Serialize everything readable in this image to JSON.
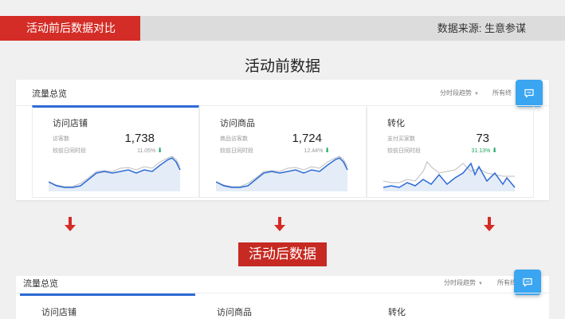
{
  "header": {
    "title": "活动前后数据对比",
    "source": "数据来源: 生意参谋"
  },
  "before": {
    "section_title": "活动前数据",
    "panel_title": "流量总览",
    "trend_select": "分时段趋势",
    "all_select": "所有终",
    "chat_icon": "chat-bubble-icon",
    "cards": [
      {
        "title": "访问店铺",
        "metric": "访客数",
        "compare": "较前日同时段",
        "value": "1,738",
        "pct": "11.05%",
        "direction": "down"
      },
      {
        "title": "访问商品",
        "metric": "商品访客数",
        "compare": "较前日同时段",
        "value": "1,724",
        "pct": "12.44%",
        "direction": "down"
      },
      {
        "title": "转化",
        "metric": "支付买家数",
        "compare": "较前日同时段",
        "value": "73",
        "pct": "31.13%",
        "direction": "down"
      }
    ]
  },
  "arrows": {
    "icon": "arrow-down-icon",
    "color": "#d42c26"
  },
  "after": {
    "section_title": "活动后数据",
    "panel_title": "流量总览",
    "trend_select": "分时段趋势",
    "all_select": "所有终",
    "tabs": [
      "访问店铺",
      "访问商品",
      "转化"
    ]
  },
  "colors": {
    "accent_red": "#d42c26",
    "accent_blue": "#2d6bd6",
    "chat_blue": "#3aa5f0",
    "down_green": "#1fa35c"
  }
}
